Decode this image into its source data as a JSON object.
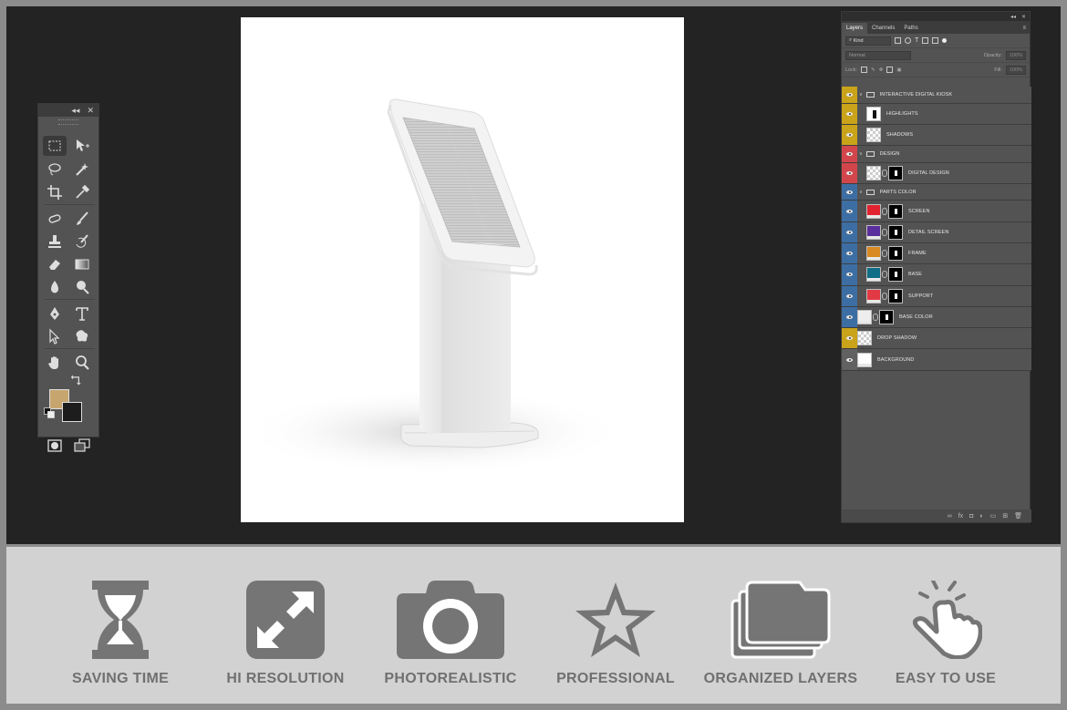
{
  "tools_panel": {
    "collapse_label": "◂◂",
    "close_label": "✕",
    "foreground_color": "#c7a56f",
    "background_color": "#1d1d1d"
  },
  "layers_panel": {
    "tabs": [
      "Layers",
      "Channels",
      "Paths"
    ],
    "filter_label": "Kind",
    "blend_mode": "Normal",
    "opacity_label": "Opacity:",
    "opacity_value": "100%",
    "lock_label": "Lock:",
    "fill_label": "Fill:",
    "fill_value": "100%",
    "layers": [
      {
        "name": "INTERACTIVE DIGITAL KIOSK",
        "kind": "group",
        "color": "#c9a31a",
        "indent": 0
      },
      {
        "name": "HIGHLIGHTS",
        "kind": "layer",
        "color": "#c9a31a",
        "indent": 1,
        "thumb": "mask-only"
      },
      {
        "name": "SHADOWS",
        "kind": "layer",
        "color": "#c9a31a",
        "indent": 1,
        "thumb": "checker"
      },
      {
        "name": "DESIGN",
        "kind": "group",
        "color": "#d2464b",
        "indent": 0
      },
      {
        "name": "DIGITAL DESIGN",
        "kind": "layer",
        "color": "#d2464b",
        "indent": 1,
        "thumb": "checker-mask"
      },
      {
        "name": "PARTS COLOR",
        "kind": "group",
        "color": "#3d6ea3",
        "indent": 0
      },
      {
        "name": "SCREEN",
        "kind": "layer",
        "color": "#3d6ea3",
        "indent": 1,
        "fill": "#e2232f"
      },
      {
        "name": "DETAIL SCREEN",
        "kind": "layer",
        "color": "#3d6ea3",
        "indent": 1,
        "fill": "#5a2e9c"
      },
      {
        "name": "FRAME",
        "kind": "layer",
        "color": "#3d6ea3",
        "indent": 1,
        "fill": "#d98a22"
      },
      {
        "name": "BASE",
        "kind": "layer",
        "color": "#3d6ea3",
        "indent": 1,
        "fill": "#0f6e86"
      },
      {
        "name": "SUPPORT",
        "kind": "layer",
        "color": "#3d6ea3",
        "indent": 1,
        "fill": "#e23a44"
      },
      {
        "name": "BASE COLOR",
        "kind": "layer",
        "color": "#3d6ea3",
        "indent": 0,
        "fill": "#eeeeee"
      },
      {
        "name": "DROP SHADOW",
        "kind": "layer",
        "color": "#c9a31a",
        "indent": 0,
        "thumb": "checker"
      },
      {
        "name": "BACKGROUND",
        "kind": "layer",
        "color": "#616161",
        "indent": 0,
        "fill": "#ffffff"
      }
    ]
  },
  "features": [
    {
      "label": "SAVING TIME",
      "icon": "hourglass-icon"
    },
    {
      "label": "HI RESOLUTION",
      "icon": "expand-arrows-icon"
    },
    {
      "label": "PHOTOREALISTIC",
      "icon": "camera-icon"
    },
    {
      "label": "PROFESSIONAL",
      "icon": "star-icon"
    },
    {
      "label": "ORGANIZED LAYERS",
      "icon": "stacked-folders-icon"
    },
    {
      "label": "EASY TO USE",
      "icon": "tap-hand-icon"
    }
  ],
  "colors": {
    "workspace": "#232323",
    "panel": "#535353",
    "feature_icon": "#757575",
    "feature_label": "#707070"
  }
}
